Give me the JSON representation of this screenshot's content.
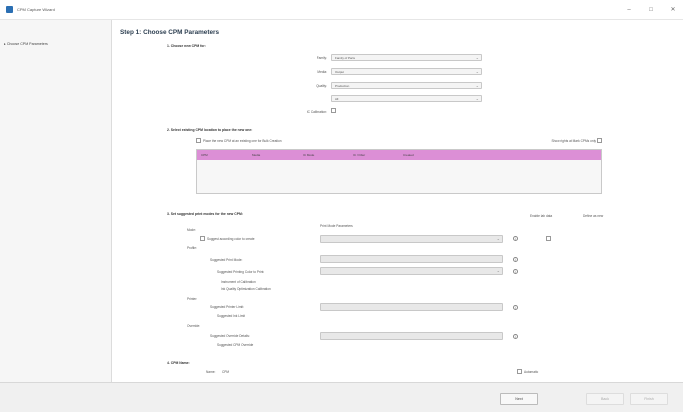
{
  "window": {
    "title": "CPM Capture Wizard",
    "minimize": "–",
    "maximize": "□",
    "close": "✕"
  },
  "sidebar": {
    "items": [
      {
        "label": "Choose CPM Parameters"
      }
    ]
  },
  "step_title": "Step 1: Choose CPM Parameters",
  "section1": {
    "title": "1. Choose new CPM for:",
    "fields": [
      {
        "label": "Family:",
        "value": "Family of Parts"
      },
      {
        "label": "Media:",
        "value": "Output"
      },
      {
        "label": "Quality:",
        "value": "Production"
      },
      {
        "label": "",
        "value": "All"
      }
    ],
    "ic_label": "IC Calibration:"
  },
  "section2": {
    "title": "2. Select existing CPM location to place the new one:",
    "checkbox_label": "Place the new CPM at an existing one for Bulk Creation",
    "right_checkbox_label": "Show rights at Mark CPMs only",
    "columns": [
      "CPM",
      "Media",
      "IC Mode",
      "IC / Filter",
      "Created"
    ]
  },
  "section3": {
    "title": "3. Set suggested print modes for the new CPM:",
    "col_header_params": "Print Mode Parameters",
    "col_header_enabled": "Enable lab data",
    "col_header_defaults": "Define as new",
    "rows": [
      {
        "label": "Mode:"
      },
      {
        "label": "Suggest according color to create",
        "indent": true
      },
      {
        "label": "Profile:"
      },
      {
        "label": "Suggested Print Mode:",
        "indent": true
      },
      {
        "label": "Suggested Printing Color to Print:",
        "indent": true
      },
      {
        "label": "Instrument of Calibration",
        "indent": true
      },
      {
        "label": "Ink Quality Optimization Calibration",
        "indent": true
      },
      {
        "label": "Printer:"
      },
      {
        "label": "Suggested Printer Limit:",
        "indent": true
      },
      {
        "label": "Suggested Ink Limit",
        "indent": true
      },
      {
        "label": "Override:"
      },
      {
        "label": "Suggested Override Details:",
        "indent": true
      },
      {
        "label": "Suggested CPM Override",
        "indent": true
      }
    ]
  },
  "section4": {
    "title": "4. CPM Name:",
    "name_label": "Name:",
    "name_value": "CPM",
    "checkbox_label": "Automatic"
  },
  "footer": {
    "next": "Next",
    "back": "Back",
    "finish": "Finish"
  },
  "colors": {
    "grid_header": "#dc8fd6",
    "title": "#2c3e50"
  }
}
